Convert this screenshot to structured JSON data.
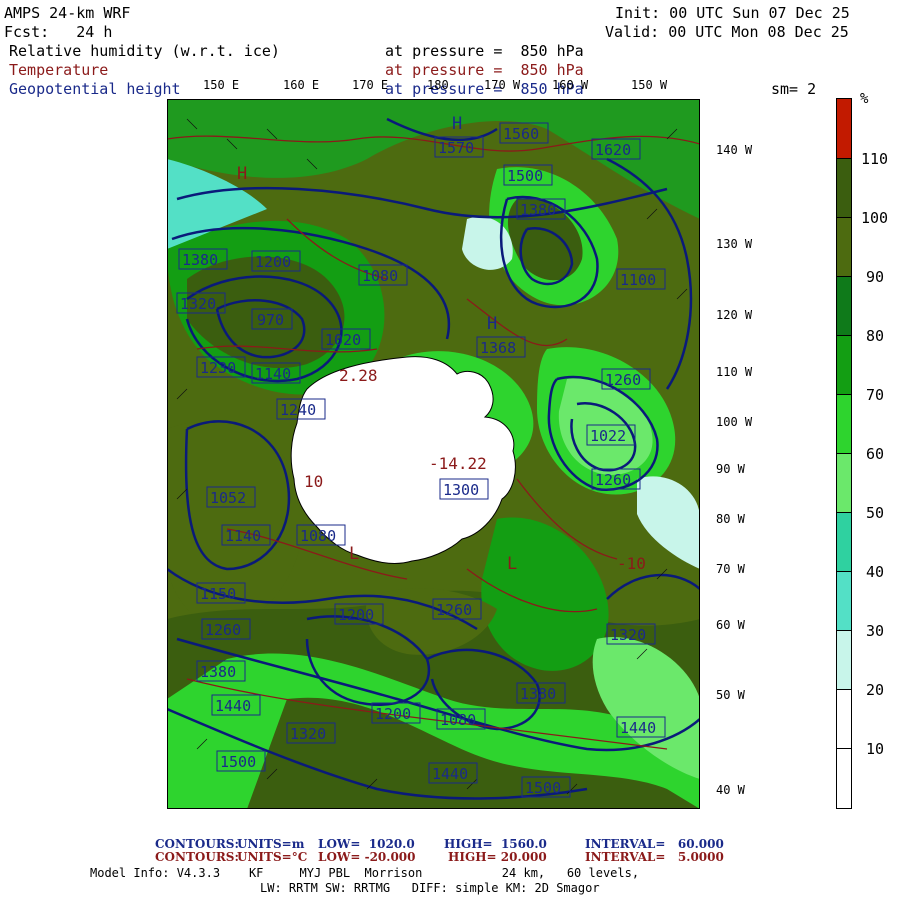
{
  "header": {
    "model": "AMPS 24-km WRF",
    "forecast": "Fcst:   24 h",
    "init": "Init: 00 UTC Sun 07 Dec 25",
    "valid": "Valid: 00 UTC Mon 08 Dec 25",
    "fields": [
      {
        "name": "Relative humidity (w.r.t. ice)",
        "level": "at pressure =  850 hPa",
        "color": "#000000"
      },
      {
        "name": "Temperature",
        "level": "at pressure =  850 hPa",
        "color": "#8b1a1a"
      },
      {
        "name": "Geopotential height",
        "level": "at pressure =  850 hPa",
        "color": "#1a2a8a"
      }
    ],
    "smoothing": "sm= 2"
  },
  "top_longitudes": [
    "150 E",
    "160 E",
    "170 E",
    "180",
    "170 W",
    "160 W",
    "150 W"
  ],
  "right_longitudes": [
    "140 W",
    "130 W",
    "120 W",
    "110 W",
    "100 W",
    "90 W",
    "80 W",
    "70 W",
    "60 W",
    "50 W",
    "40 W"
  ],
  "colorbar": {
    "unit": "%",
    "labels": [
      "110",
      "100",
      "90",
      "80",
      "70",
      "60",
      "50",
      "40",
      "30",
      "20",
      "10"
    ],
    "colors": [
      "#c21a00",
      "#3b5e0f",
      "#4d6b10",
      "#0f7a1a",
      "#139e13",
      "#2ed42e",
      "#6be86b",
      "#2fd1a0",
      "#53e0c6",
      "#c8f5ea",
      "#ffffff",
      "#ffffff"
    ]
  },
  "map_labels": {
    "heights": [
      "1560",
      "1570",
      "1500",
      "1620",
      "1380",
      "1320",
      "1200",
      "970",
      "1020",
      "1140",
      "1080",
      "1380",
      "1100",
      "1260",
      "1240",
      "1052",
      "1140",
      "1080",
      "1260",
      "1200",
      "1380",
      "1440",
      "1320",
      "1200",
      "1080",
      "1150",
      "1260",
      "1500",
      "1440",
      "1500",
      "1300",
      "1368",
      "1022",
      "1230",
      "1260",
      "1320",
      "1440",
      "1380"
    ],
    "highs": [
      "H",
      "H",
      "H"
    ],
    "lows": [
      "L",
      "L"
    ],
    "temperatures": [
      "2.28",
      "-14.22",
      "10",
      "-10"
    ],
    "colors": {
      "height_contour": "#0a1a7a",
      "temp_contour": "#8b1a1a",
      "land": "#ffffff"
    }
  },
  "footer": {
    "contours1": {
      "label": "CONTOURS:",
      "units": "UNITS=m",
      "low": "LOW=  1020.0",
      "high": "HIGH=  1560.0",
      "interval": "INTERVAL=   60.000"
    },
    "contours2": {
      "label": "CONTOURS:",
      "units": "UNITS=°C",
      "low": "LOW= -20.000",
      "high": "HIGH= 20.000",
      "interval": "INTERVAL=   5.0000"
    },
    "model_info": "Model Info: V4.3.3    KF     MYJ PBL  Morrison           24 km,   60 levels,",
    "model_info2": "LW: RRTM SW: RRTMG   DIFF: simple KM: 2D Smagor"
  }
}
